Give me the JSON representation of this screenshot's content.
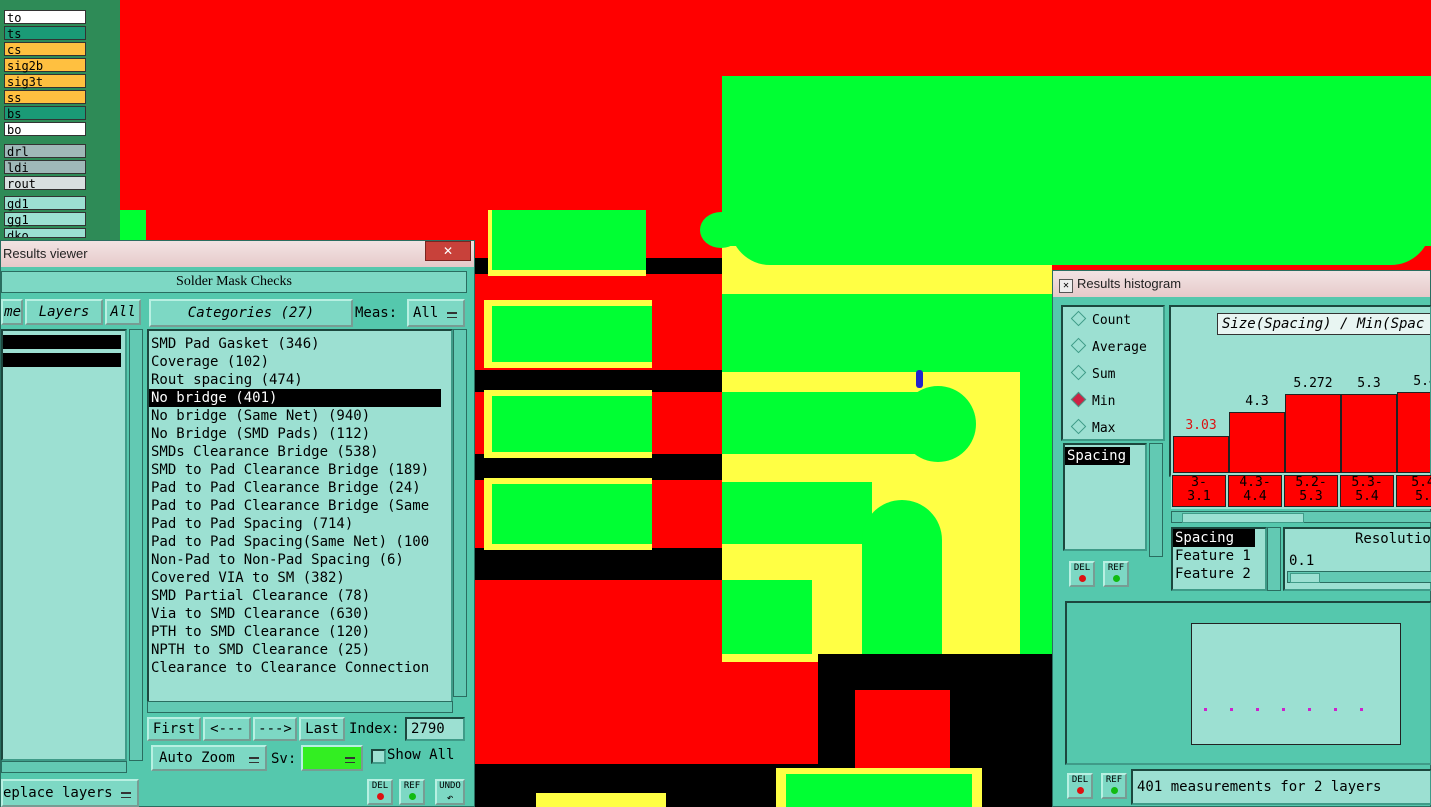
{
  "layers": [
    {
      "label": "to",
      "color": "#ffffff"
    },
    {
      "label": "ts",
      "color": "#1a9a76"
    },
    {
      "label": "cs",
      "color": "#ffc040"
    },
    {
      "label": "sig2b",
      "color": "#ffc040"
    },
    {
      "label": "sig3t",
      "color": "#ffc040"
    },
    {
      "label": "ss",
      "color": "#ffc040"
    },
    {
      "label": "bs",
      "color": "#1a9a76"
    },
    {
      "label": "bo",
      "color": "#ffffff"
    },
    {
      "label": "drl",
      "color": "#9fb8b8"
    },
    {
      "label": "ldi",
      "color": "#9fb8b8"
    },
    {
      "label": "rout",
      "color": "#d8e0e0"
    },
    {
      "label": "gd1",
      "color": "#9ce0d2"
    },
    {
      "label": "gg1",
      "color": "#9ce0d2"
    },
    {
      "label": "dko",
      "color": "#9ce0d2"
    }
  ],
  "results_viewer": {
    "title": "Results viewer",
    "close": "✕",
    "header": "Solder Mask Checks",
    "tab_name_partial": "me",
    "tab_layers": "Layers",
    "tab_all": "All",
    "categories_label": "Categories (27)",
    "meas_label": "Meas:",
    "meas_value": "All",
    "categories": [
      "SMD Pad Gasket (346)",
      "Coverage (102)",
      "Rout spacing (474)",
      "No bridge (401)",
      "No bridge (Same Net) (940)",
      "No Bridge (SMD Pads) (112)",
      "SMDs Clearance Bridge (538)",
      "SMD to Pad Clearance Bridge (189)",
      "Pad to Pad Clearance Bridge (24)",
      "Pad to Pad Clearance Bridge (Same",
      "Pad to Pad Spacing (714)",
      "Pad to Pad Spacing(Same Net) (100",
      "Non-Pad to Non-Pad Spacing (6)",
      "Covered VIA to SM (382)",
      "SMD Partial Clearance (78)",
      "Via to SMD Clearance (630)",
      "PTH to SMD Clearance (120)",
      "NPTH to SMD Clearance (25)",
      "Clearance to Clearance Connection"
    ],
    "selected_category": 3,
    "nav": {
      "first": "First",
      "prev": "<---",
      "next": "--->",
      "last": "Last",
      "index_label": "Index:",
      "index_value": "2790"
    },
    "auto_zoom": "Auto Zoom",
    "sv_label": "Sv:",
    "show_all": "Show All",
    "replace_layers": "eplace layers",
    "del": "DEL",
    "ref": "REF",
    "undo": "UNDO"
  },
  "histogram": {
    "title": "Results histogram",
    "modes": [
      "Count",
      "Average",
      "Sum",
      "Min",
      "Max"
    ],
    "selected_mode": "Min",
    "attribute_list": [
      "Spacing"
    ],
    "chart_title": "Size(Spacing) / Min(Spac",
    "bars": [
      {
        "value": "3.03",
        "range": "3-\n3.1",
        "level": 3.03,
        "highlight": true
      },
      {
        "value": "4.3",
        "range": "4.3-\n4.4",
        "level": 4.3,
        "highlight": false
      },
      {
        "value": "5.272",
        "range": "5.2-\n5.3",
        "level": 5.272,
        "highlight": false
      },
      {
        "value": "5.3",
        "range": "5.3-\n5.4",
        "level": 5.3,
        "highlight": false
      },
      {
        "value": "5.4",
        "range": "5.4\n5.",
        "level": 5.4,
        "highlight": false
      }
    ],
    "attrs": [
      "Spacing",
      "Feature 1",
      "Feature 2"
    ],
    "resolution_label": "Resolutio",
    "resolution_value": "0.1",
    "status": "401 measurements for 2 layers",
    "del": "DEL",
    "ref": "REF"
  },
  "colors": {
    "copper": "#00ff33",
    "mask": "#ff0000",
    "clearance": "#ffff44",
    "panel": "#55c8ad"
  }
}
